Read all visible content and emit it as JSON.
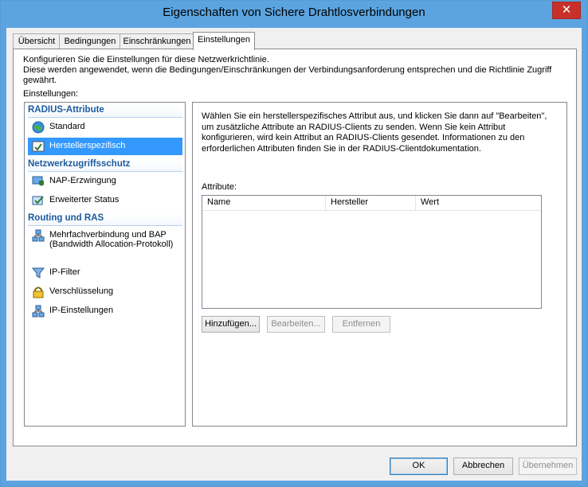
{
  "window": {
    "title": "Eigenschaften von Sichere Drahtlosverbindungen",
    "close_glyph": "✕"
  },
  "tabs": [
    {
      "label": "Übersicht",
      "active": false
    },
    {
      "label": "Bedingungen",
      "active": false
    },
    {
      "label": "Einschränkungen",
      "active": false
    },
    {
      "label": "Einstellungen",
      "active": true
    }
  ],
  "description": {
    "line1": "Konfigurieren Sie die Einstellungen für diese Netzwerkrichtlinie.",
    "line2": "Diese werden angewendet, wenn die Bedingungen/Einschränkungen der Verbindungsanforderung entsprechen und die Richtlinie Zugriff gewährt."
  },
  "settings_label": "Einstellungen:",
  "nav": {
    "groups": [
      {
        "header": "RADIUS-Attribute",
        "items": [
          {
            "label": "Standard",
            "icon": "globe-icon",
            "selected": false
          },
          {
            "label": "Herstellerspezifisch",
            "icon": "vendor-icon",
            "selected": true
          }
        ]
      },
      {
        "header": "Netzwerkzugriffsschutz",
        "items": [
          {
            "label": "NAP-Erzwingung",
            "icon": "nap-shield-icon",
            "selected": false
          },
          {
            "label": "Erweiterter Status",
            "icon": "status-check-icon",
            "selected": false
          }
        ]
      },
      {
        "header": "Routing und RAS",
        "items": [
          {
            "label": "Mehrfachverbindung und BAP (Bandwidth Allocation-Protokoll)",
            "icon": "network-icon",
            "selected": false
          },
          {
            "label": "IP-Filter",
            "icon": "funnel-icon",
            "selected": false
          },
          {
            "label": "Verschlüsselung",
            "icon": "lock-icon",
            "selected": false
          },
          {
            "label": "IP-Einstellungen",
            "icon": "network-icon",
            "selected": false
          }
        ]
      }
    ]
  },
  "detail": {
    "info_lines": [
      "Wählen Sie ein herstellerspezifisches Attribut aus, und klicken Sie dann auf \"Bearbeiten\",",
      "um zusätzliche Attribute an RADIUS-Clients zu senden. Wenn Sie kein Attribut",
      "konfigurieren, wird kein Attribut an RADIUS-Clients gesendet. Informationen zu den",
      "erforderlichen Attributen finden Sie in der RADIUS-Clientdokumentation."
    ],
    "attributes_label": "Attribute:",
    "columns": [
      "Name",
      "Hersteller",
      "Wert"
    ],
    "rows": [],
    "buttons": {
      "add": "Hinzufügen...",
      "edit": "Bearbeiten...",
      "remove": "Entfernen"
    }
  },
  "footer": {
    "ok": "OK",
    "cancel": "Abbrechen",
    "apply": "Übernehmen"
  }
}
